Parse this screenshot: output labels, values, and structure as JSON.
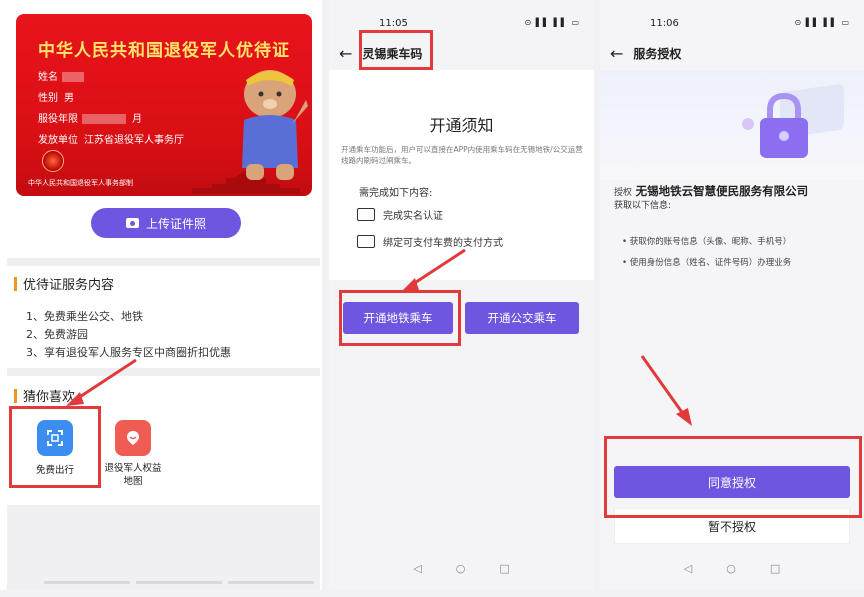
{
  "panel1": {
    "card": {
      "title": "中华人民共和国退役军人优待证",
      "name_label": "姓名",
      "gender_label": "性别",
      "gender_value": "男",
      "service_label": "服役年限",
      "service_suffix": "月",
      "issuer_label": "发放单位",
      "issuer_value": "江苏省退役军人事务厅",
      "footer": "中华人民共和国退役军人事务部制"
    },
    "upload_button": "上传证件照",
    "services_title": "优待证服务内容",
    "services": [
      "1、免费乘坐公交、地铁",
      "2、免费游园",
      "3、享有退役军人服务专区中商圈折扣优惠"
    ],
    "recommend_title": "猜你喜欢",
    "apps": [
      {
        "label": "免费出行",
        "icon": "scan-icon",
        "color": "#3c8df0"
      },
      {
        "label": "退役军人权益地图",
        "icon": "map-pin-icon",
        "color": "#ef5c54"
      }
    ]
  },
  "panel2": {
    "time": "11:05",
    "status_icons": "⊙ ▌▌ ▌▌ ▭",
    "title": "灵锡乘车码",
    "notice_title": "开通须知",
    "notice_text": "开通乘车功能后，用户可以直接在APP内使用乘车码在无锡地铁/公交运营线路内刷码过闸乘车。",
    "req_header": "需完成如下内容:",
    "requirements": [
      "完成实名认证",
      "绑定可支付车费的支付方式"
    ],
    "btn_metro": "开通地铁乘车",
    "btn_bus": "开通公交乘车"
  },
  "panel3": {
    "time": "11:06",
    "status_icons": "⊙ ▌▌ ▌▌ ▭",
    "title": "服务授权",
    "org_prefix": "授权",
    "org_name": "无锡地铁云智慧便民服务有限公司",
    "sub": "获取以下信息:",
    "bullets": [
      "获取你的账号信息（头像、昵称、手机号）",
      "使用身份信息（姓名、证件号码）办理业务"
    ],
    "agree": "同意授权",
    "decline": "暂不授权"
  },
  "sysnav": [
    "◁",
    "○",
    "□"
  ],
  "colors": {
    "accent": "#6f55e0",
    "card_red": "#d80f14",
    "highlight": "#e03a3a",
    "title_gold": "#ffe36b"
  }
}
